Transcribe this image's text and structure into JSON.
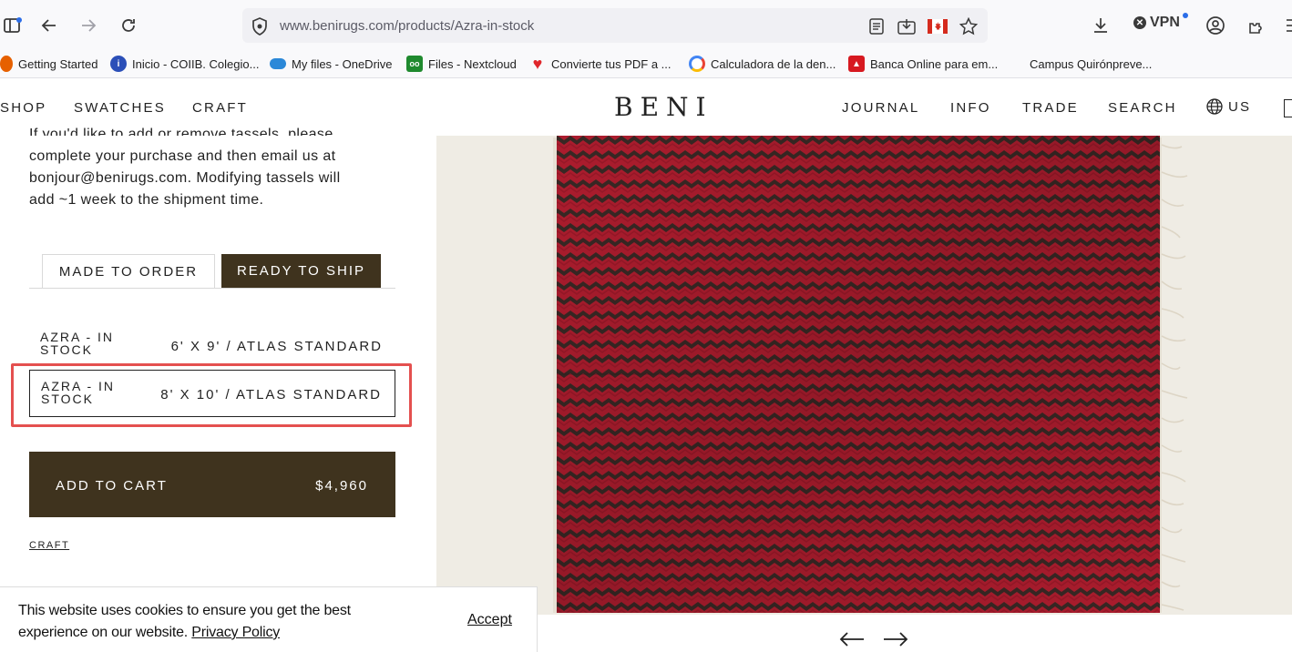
{
  "browser": {
    "url": "www.benirugs.com/products/Azra-in-stock",
    "vpn_label": "VPN",
    "bookmarks": [
      {
        "label": "Getting Started",
        "icon": "firefox-icon",
        "color": "#e66000"
      },
      {
        "label": "Inicio - COIIB. Colegio...",
        "icon": "coiib-icon",
        "color": "#2b4fb8"
      },
      {
        "label": "My files - OneDrive",
        "icon": "onedrive-icon",
        "color": "#2b88d8"
      },
      {
        "label": "Files - Nextcloud",
        "icon": "nextcloud-icon",
        "color": "#1f8a2e"
      },
      {
        "label": "Convierte tus PDF a ...",
        "icon": "heart-icon",
        "color": "#e0262b"
      },
      {
        "label": "Calculadora de la den...",
        "icon": "google-icon",
        "color": "#4285f4"
      },
      {
        "label": "Banca Online para em...",
        "icon": "bank-icon",
        "color": "#d71920"
      },
      {
        "label": "Campus Quirónpreve...",
        "icon": "",
        "color": ""
      }
    ]
  },
  "nav": {
    "left": [
      "SHOP",
      "SWATCHES",
      "CRAFT"
    ],
    "logo": "BENI",
    "right": [
      "JOURNAL",
      "INFO",
      "TRADE",
      "SEARCH"
    ],
    "region": "US"
  },
  "product": {
    "description_lines": [
      "If you'd like to add or remove tassels, please",
      "complete your purchase and then email us at",
      "bonjour@benirugs.com. Modifying tassels will",
      "add ~1 week to the shipment time."
    ],
    "tabs": {
      "made_to_order": "MADE TO ORDER",
      "ready_to_ship": "READY TO SHIP",
      "active": "ready_to_ship"
    },
    "variants": [
      {
        "name": "AZRA - IN STOCK",
        "size": "6' X 9' / ATLAS STANDARD",
        "selected": false
      },
      {
        "name": "AZRA - IN STOCK",
        "size": "8' X 10' / ATLAS STANDARD",
        "selected": true
      }
    ],
    "add_to_cart": "ADD TO CART",
    "price": "$4,960",
    "craft_link": "CRAFT"
  },
  "cookie": {
    "text_line1": "This website uses cookies to ensure you get the best",
    "text_line2": "experience on our website.",
    "policy_link": "Privacy Policy",
    "accept": "Accept"
  },
  "colors": {
    "brand_dark": "#3f331e",
    "highlight": "#e4504f",
    "rug_red": "#b51e30",
    "rug_dark": "#3b2a26",
    "image_bg": "#efece4"
  }
}
